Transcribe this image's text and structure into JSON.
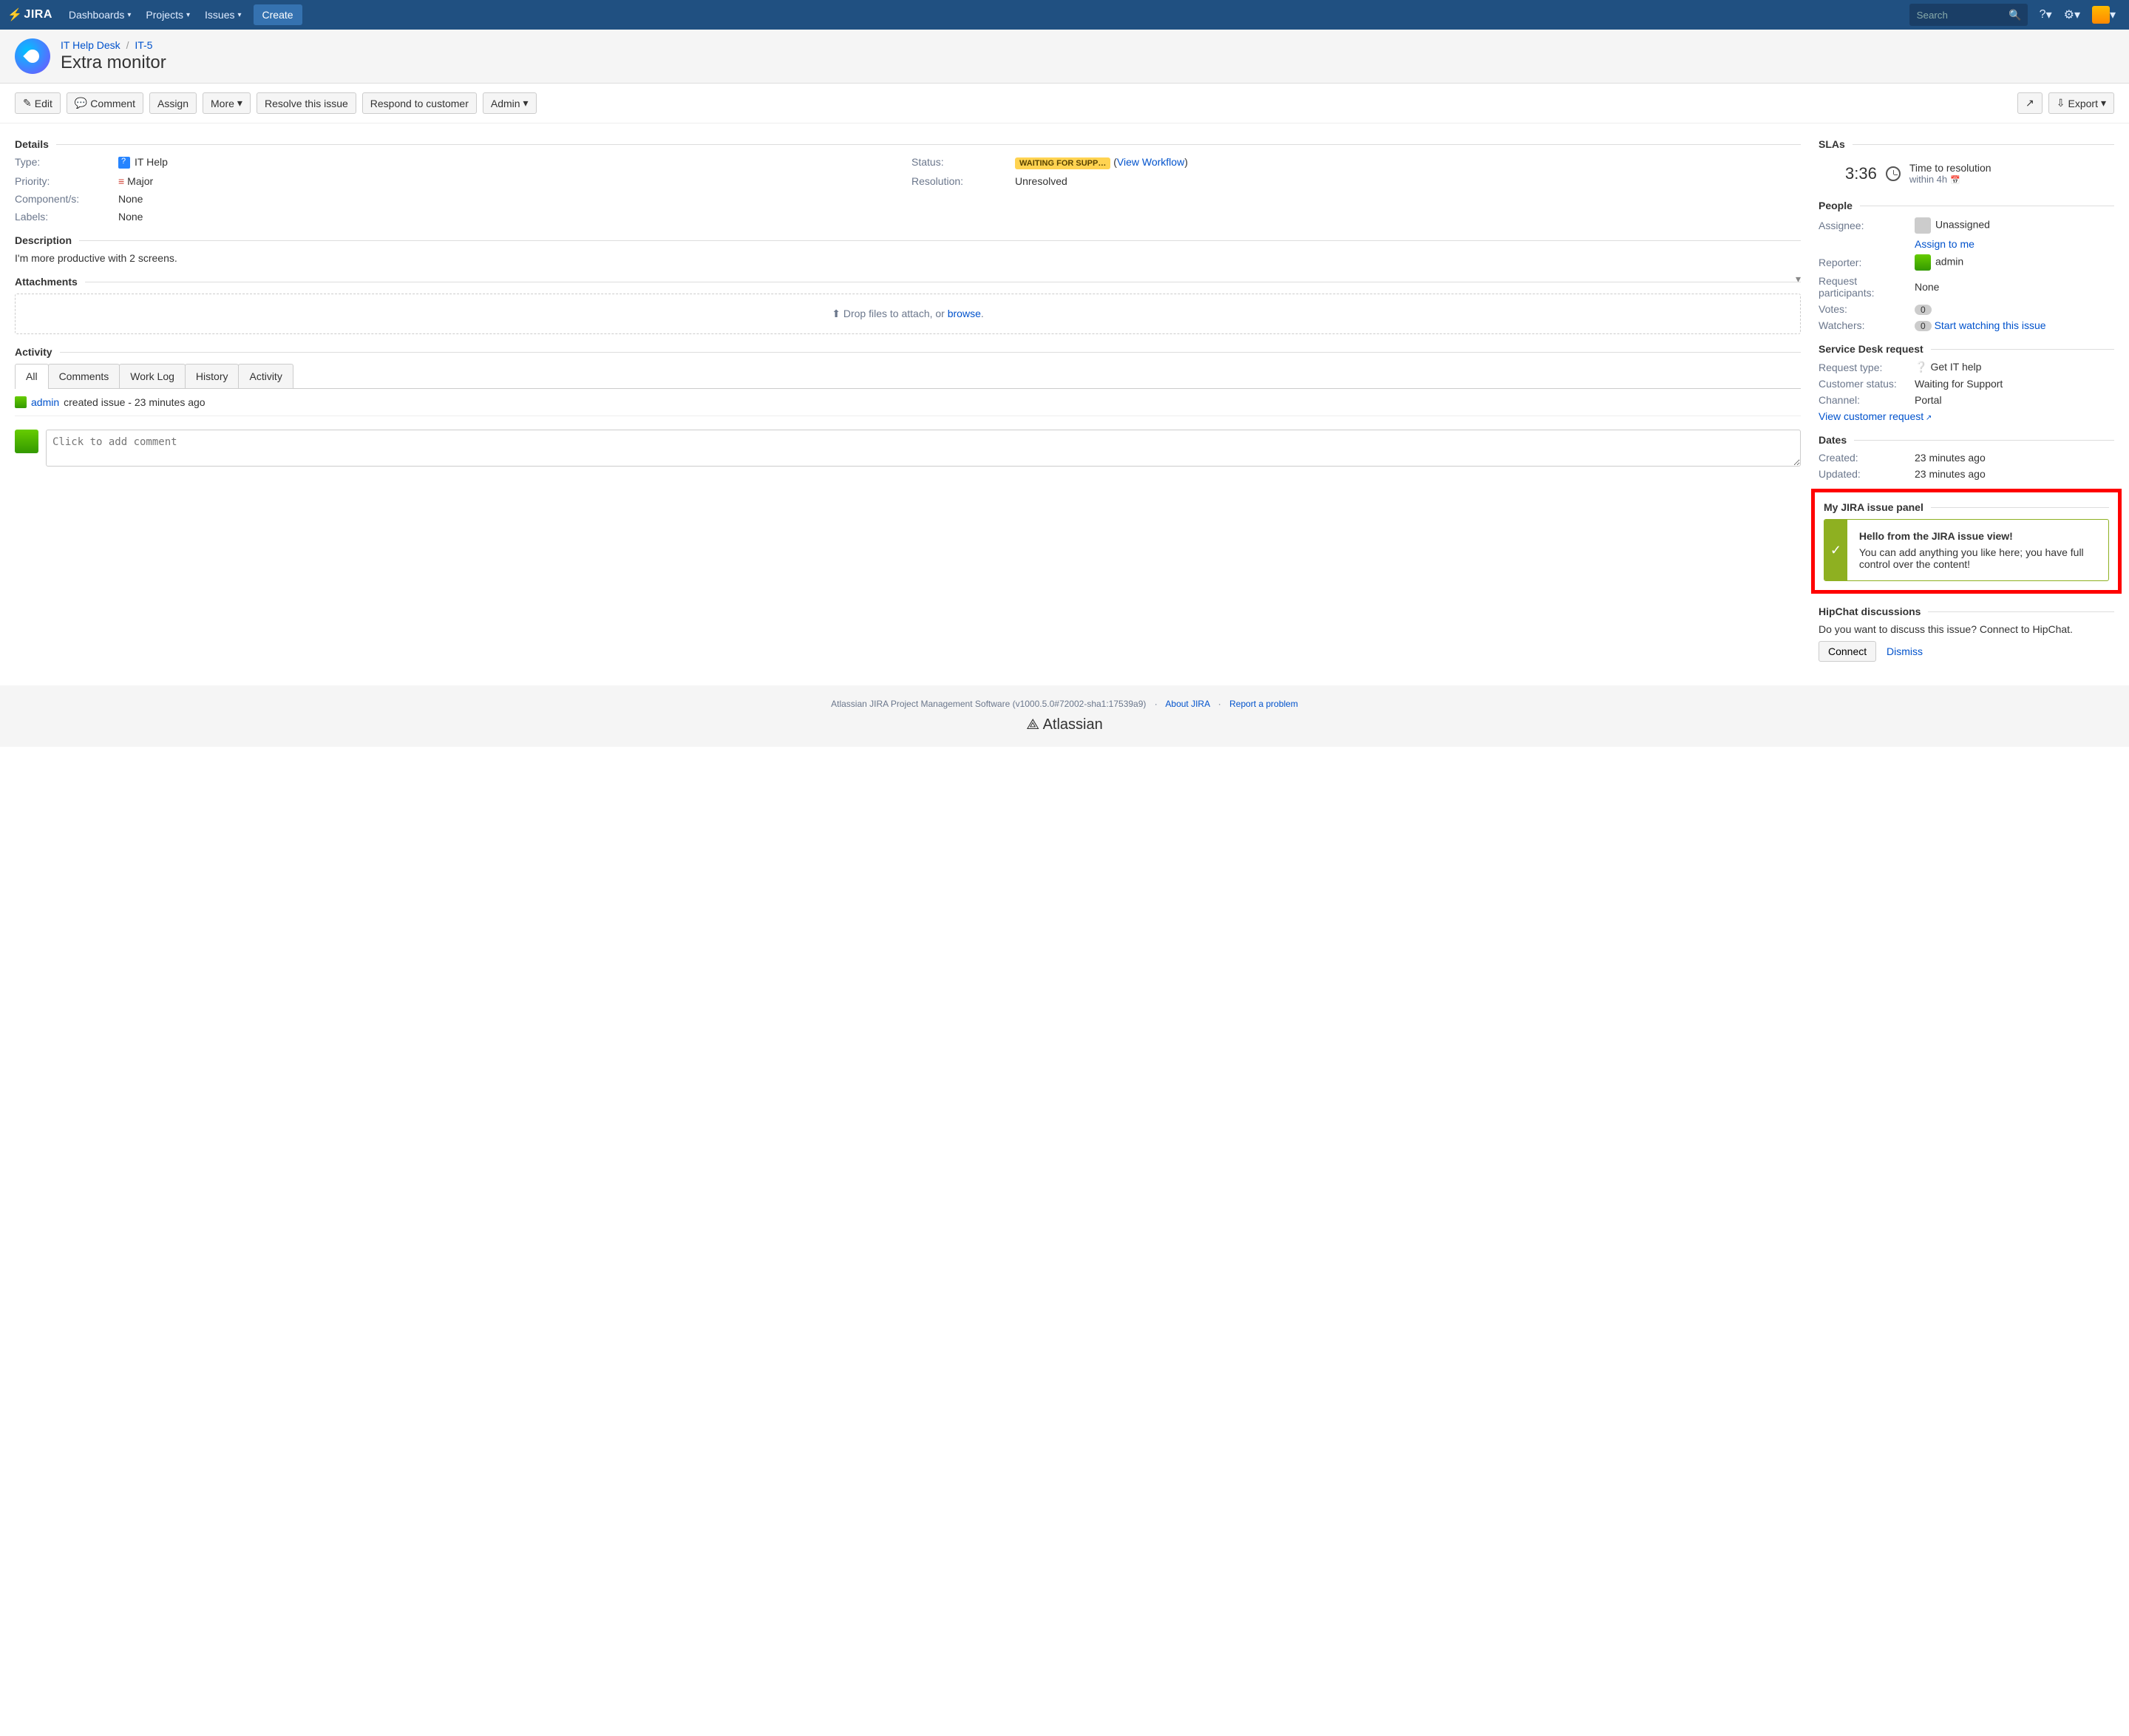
{
  "nav": {
    "brand": "JIRA",
    "items": [
      "Dashboards",
      "Projects",
      "Issues"
    ],
    "create": "Create",
    "search_placeholder": "Search"
  },
  "breadcrumb": {
    "project": "IT Help Desk",
    "key": "IT-5",
    "sep": "/"
  },
  "issue": {
    "summary": "Extra monitor"
  },
  "toolbar": {
    "edit": "Edit",
    "comment": "Comment",
    "assign": "Assign",
    "more": "More",
    "resolve": "Resolve this issue",
    "respond": "Respond to customer",
    "admin": "Admin",
    "export": "Export"
  },
  "sections": {
    "details": "Details",
    "description": "Description",
    "attachments": "Attachments",
    "activity": "Activity",
    "slas": "SLAs",
    "people": "People",
    "sdreq": "Service Desk request",
    "dates": "Dates",
    "custom": "My JIRA issue panel",
    "hipchat": "HipChat discussions"
  },
  "details": {
    "type_lbl": "Type:",
    "type_val": "IT Help",
    "priority_lbl": "Priority:",
    "priority_val": "Major",
    "components_lbl": "Component/s:",
    "components_val": "None",
    "labels_lbl": "Labels:",
    "labels_val": "None",
    "status_lbl": "Status:",
    "status_val": "WAITING FOR SUPP…",
    "workflow_link": "View Workflow",
    "resolution_lbl": "Resolution:",
    "resolution_val": "Unresolved"
  },
  "description": {
    "text": "I'm more productive with 2 screens."
  },
  "attachments": {
    "drop_pre": "Drop files to attach, or ",
    "browse": "browse",
    "drop_post": "."
  },
  "tabs": {
    "all": "All",
    "comments": "Comments",
    "worklog": "Work Log",
    "history": "History",
    "activity": "Activity"
  },
  "activity": {
    "user": "admin",
    "action": "created issue - 23 minutes ago"
  },
  "comment": {
    "placeholder": "Click to add comment"
  },
  "sla": {
    "time": "3:36",
    "title": "Time to resolution",
    "within": "within 4h"
  },
  "people": {
    "assignee_lbl": "Assignee:",
    "assignee_val": "Unassigned",
    "assign_me": "Assign to me",
    "reporter_lbl": "Reporter:",
    "reporter_val": "admin",
    "participants_lbl": "Request participants:",
    "participants_val": "None",
    "votes_lbl": "Votes:",
    "votes_val": "0",
    "watchers_lbl": "Watchers:",
    "watchers_val": "0",
    "watch_link": "Start watching this issue"
  },
  "sdreq": {
    "reqtype_lbl": "Request type:",
    "reqtype_val": "Get IT help",
    "status_lbl": "Customer status:",
    "status_val": "Waiting for Support",
    "channel_lbl": "Channel:",
    "channel_val": "Portal",
    "view_link": "View customer request"
  },
  "dates": {
    "created_lbl": "Created:",
    "created_val": "23 minutes ago",
    "updated_lbl": "Updated:",
    "updated_val": "23 minutes ago"
  },
  "custom_panel": {
    "title": "Hello from the JIRA issue view!",
    "body": "You can add anything you like here; you have full control over the content!"
  },
  "hipchat": {
    "prompt": "Do you want to discuss this issue? Connect to HipChat.",
    "connect": "Connect",
    "dismiss": "Dismiss"
  },
  "footer": {
    "line": "Atlassian JIRA Project Management Software (v1000.5.0#72002-sha1:17539a9)",
    "about": "About JIRA",
    "report": "Report a problem",
    "brand": "Atlassian"
  }
}
